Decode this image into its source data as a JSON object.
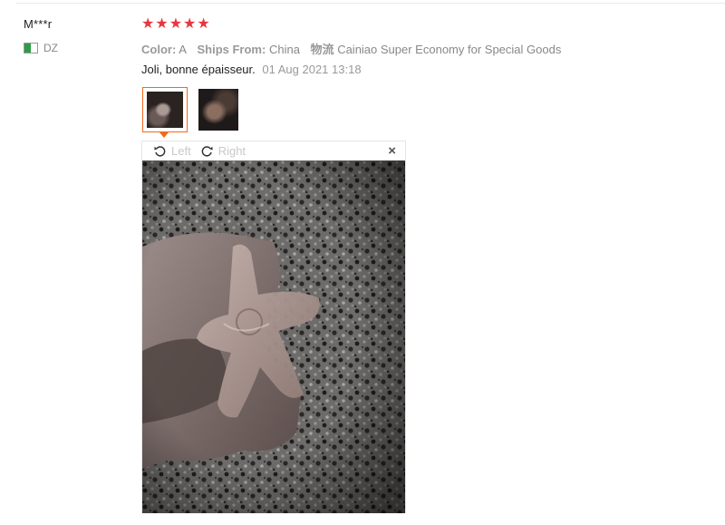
{
  "reviewer": {
    "name": "M***r",
    "country_code": "DZ",
    "flag_colors": {
      "green": "#2f9a48",
      "white": "#ffffff"
    }
  },
  "rating": {
    "value": 5,
    "max": 5,
    "color": "#e8363f"
  },
  "attributes": {
    "color_label": "Color:",
    "color_value": "A",
    "ships_label": "Ships From:",
    "ships_value": "China",
    "logistics_label": "物流",
    "logistics_value": "Cainiao Super Economy for Special Goods"
  },
  "review": {
    "text": "Joli, bonne épaisseur.",
    "date": "01 Aug 2021 13:18"
  },
  "thumbnails": [
    {
      "id": "photo-1",
      "selected": true
    },
    {
      "id": "photo-2",
      "selected": false
    }
  ],
  "viewer": {
    "rotate_left_label": "Left",
    "rotate_right_label": "Right",
    "close_glyph": "×",
    "icons": [
      "rotate-left-icon",
      "rotate-right-icon",
      "close-icon"
    ]
  },
  "accent_color": "#f06a1a"
}
